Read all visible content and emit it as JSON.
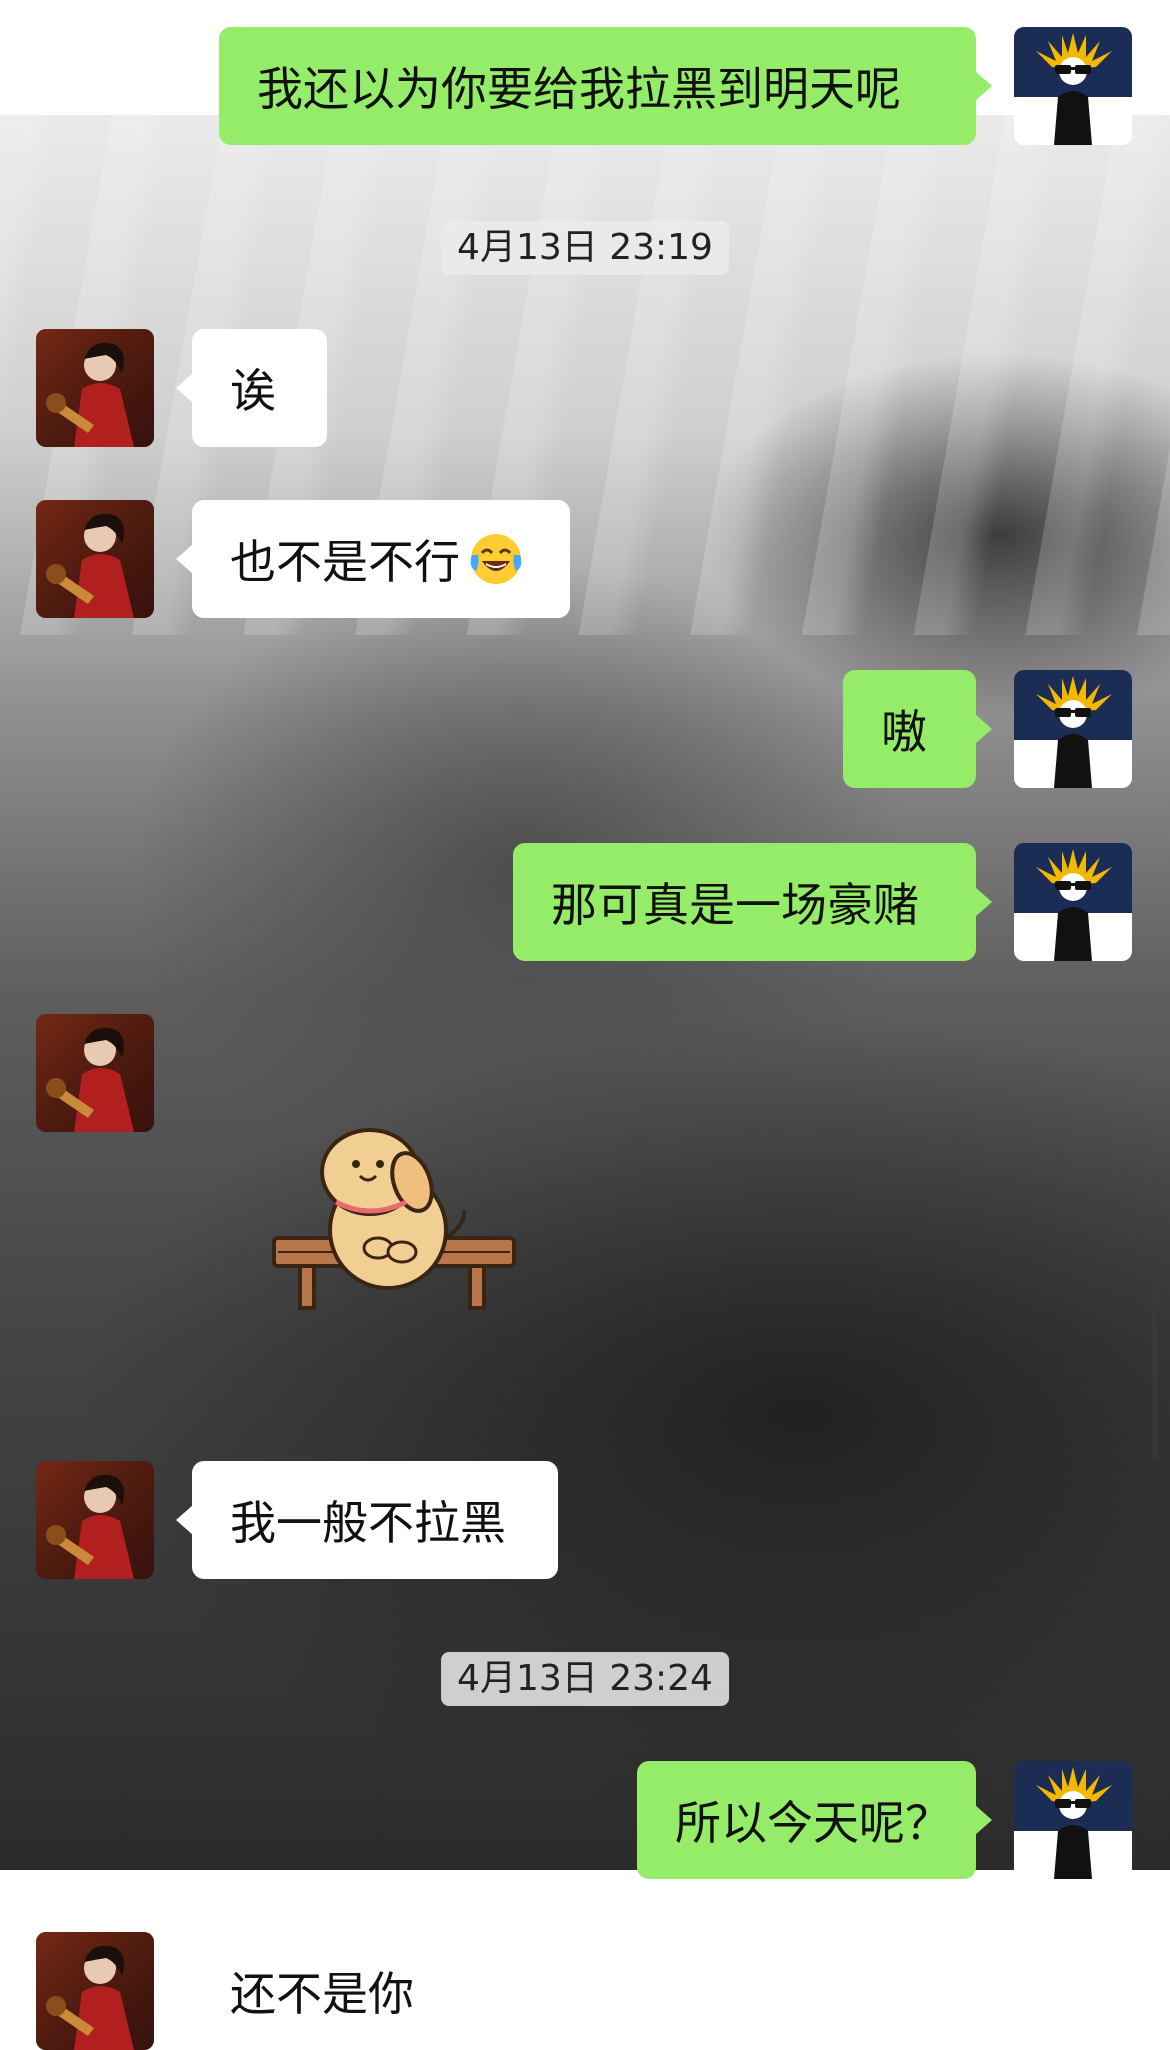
{
  "chat": {
    "timestamps": [
      "4月13日 23:19",
      "4月13日 23:24"
    ],
    "messages": [
      {
        "side": "out",
        "text": "我还以为你要给我拉黑到明天呢"
      },
      {
        "side": "in",
        "text": "诶"
      },
      {
        "side": "in",
        "text": "也不是不行"
      },
      {
        "side": "out",
        "text": "嗷"
      },
      {
        "side": "out",
        "text": "那可真是一场豪赌"
      },
      {
        "side": "in",
        "sticker": "dog-on-bench-sticker"
      },
      {
        "side": "in",
        "text": "我一般不拉黑"
      },
      {
        "side": "out",
        "text": "所以今天呢？"
      },
      {
        "side": "in",
        "text": "还不是你"
      }
    ],
    "emoji_icon": "laughing-tears-emoji",
    "colors": {
      "outgoing_bubble": "#95ec69",
      "incoming_bubble": "#ffffff",
      "time_badge": "#ebebeb"
    }
  }
}
